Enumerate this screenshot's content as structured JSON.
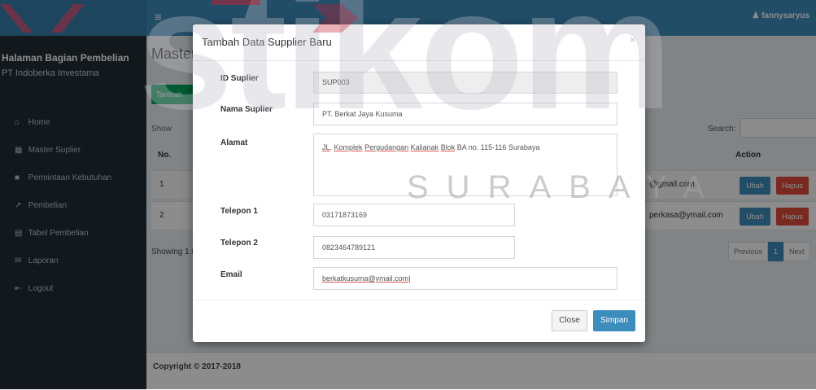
{
  "header": {
    "user": "fannysaryus"
  },
  "sidebar": {
    "title": "Halaman Bagian Pembelian",
    "company": "PT Indoberka Investama",
    "items": [
      {
        "icon": "home-icon",
        "glyph": "⌂",
        "label": "Home"
      },
      {
        "icon": "table-icon",
        "glyph": "▦",
        "label": "Master Suplier"
      },
      {
        "icon": "folder-icon",
        "glyph": "■",
        "label": "Permintaan Kebutuhan"
      },
      {
        "icon": "cart-icon",
        "glyph": "↗",
        "label": "Pembelian"
      },
      {
        "icon": "list-icon",
        "glyph": "▤",
        "label": "Tabel Pembelian"
      },
      {
        "icon": "envelope-icon",
        "glyph": "✉",
        "label": "Laporan"
      },
      {
        "icon": "logout-icon",
        "glyph": "⇤",
        "label": "Logout"
      }
    ]
  },
  "main": {
    "page_title": "Master",
    "add_button": "Tambah",
    "show_label": "Show",
    "search_label": "Search:",
    "columns": {
      "no": "No.",
      "action": "Action"
    },
    "rows": [
      {
        "no": "1",
        "email": "@gmail.com",
        "edit": "Ubah",
        "delete": "Hapus"
      },
      {
        "no": "2",
        "email": "perkasa@ymail.com",
        "edit": "Ubah",
        "delete": "Hapus"
      }
    ],
    "showing": "Showing 1 t",
    "pagination": {
      "prev": "Previous",
      "page": "1",
      "next": "Next"
    }
  },
  "footer": {
    "copyright": "Copyright © 2017-2018"
  },
  "modal": {
    "title": "Tambah Data Supplier Baru",
    "close_x": "×",
    "fields": {
      "id": {
        "label": "ID Suplier",
        "value": "SUP003"
      },
      "nama": {
        "label": "Nama Suplier",
        "value": "PT. Berkat Jaya Kusuma"
      },
      "alamat": {
        "label": "Alamat",
        "parts": [
          "JL",
          ". ",
          "Komplek",
          " ",
          "Pergudangan",
          " ",
          "Kalianak",
          " ",
          "Blok",
          " BA no. 115-116 Surabaya"
        ]
      },
      "telp1": {
        "label": "Telepon 1",
        "value": "03171873169"
      },
      "telp2": {
        "label": "Telepon 2",
        "value": "0823464789121"
      },
      "email": {
        "label": "Email",
        "value": "berkatkusuma@ymail.com"
      }
    },
    "close_button": "Close",
    "save_button": "Simpan"
  },
  "watermark": {
    "logo_text": "stikom",
    "city": "SURABAYA"
  }
}
